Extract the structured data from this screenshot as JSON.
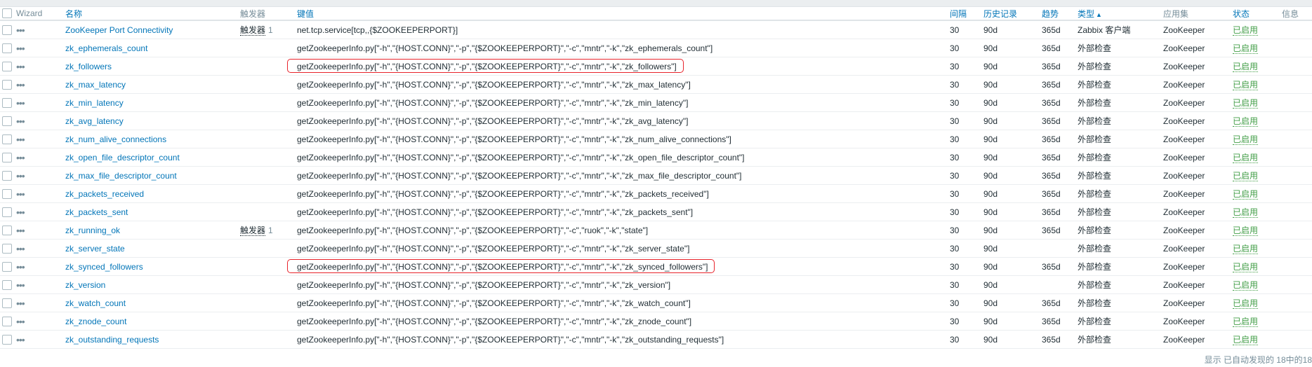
{
  "header": {
    "wizard": "Wizard",
    "name": "名称",
    "triggers": "触发器",
    "key": "键值",
    "interval": "间隔",
    "history": "历史记录",
    "trends": "趋势",
    "type": "类型",
    "sort_arrow": "▲",
    "application": "应用集",
    "status": "状态",
    "info": "信息"
  },
  "rows": [
    {
      "name": "ZooKeeper Port Connectivity",
      "trigger": "触发器",
      "trigger_count": "1",
      "key": "net.tcp.service[tcp,,{$ZOOKEEPERPORT}]",
      "interval": "30",
      "history": "90d",
      "trends": "365d",
      "type": "Zabbix 客户端",
      "app": "ZooKeeper",
      "status": "已启用",
      "highlight": false
    },
    {
      "name": "zk_ephemerals_count",
      "trigger": "",
      "trigger_count": "",
      "key": "getZookeeperInfo.py[\"-h\",\"{HOST.CONN}\",\"-p\",\"{$ZOOKEEPERPORT}\",\"-c\",\"mntr\",\"-k\",\"zk_ephemerals_count\"]",
      "interval": "30",
      "history": "90d",
      "trends": "365d",
      "type": "外部检查",
      "app": "ZooKeeper",
      "status": "已启用",
      "highlight": false
    },
    {
      "name": "zk_followers",
      "trigger": "",
      "trigger_count": "",
      "key": "getZookeeperInfo.py[\"-h\",\"{HOST.CONN}\",\"-p\",\"{$ZOOKEEPERPORT}\",\"-c\",\"mntr\",\"-k\",\"zk_followers\"]",
      "interval": "30",
      "history": "90d",
      "trends": "365d",
      "type": "外部检查",
      "app": "ZooKeeper",
      "status": "已启用",
      "highlight": true
    },
    {
      "name": "zk_max_latency",
      "trigger": "",
      "trigger_count": "",
      "key": "getZookeeperInfo.py[\"-h\",\"{HOST.CONN}\",\"-p\",\"{$ZOOKEEPERPORT}\",\"-c\",\"mntr\",\"-k\",\"zk_max_latency\"]",
      "interval": "30",
      "history": "90d",
      "trends": "365d",
      "type": "外部检查",
      "app": "ZooKeeper",
      "status": "已启用",
      "highlight": false
    },
    {
      "name": "zk_min_latency",
      "trigger": "",
      "trigger_count": "",
      "key": "getZookeeperInfo.py[\"-h\",\"{HOST.CONN}\",\"-p\",\"{$ZOOKEEPERPORT}\",\"-c\",\"mntr\",\"-k\",\"zk_min_latency\"]",
      "interval": "30",
      "history": "90d",
      "trends": "365d",
      "type": "外部检查",
      "app": "ZooKeeper",
      "status": "已启用",
      "highlight": false
    },
    {
      "name": "zk_avg_latency",
      "trigger": "",
      "trigger_count": "",
      "key": "getZookeeperInfo.py[\"-h\",\"{HOST.CONN}\",\"-p\",\"{$ZOOKEEPERPORT}\",\"-c\",\"mntr\",\"-k\",\"zk_avg_latency\"]",
      "interval": "30",
      "history": "90d",
      "trends": "365d",
      "type": "外部检查",
      "app": "ZooKeeper",
      "status": "已启用",
      "highlight": false
    },
    {
      "name": "zk_num_alive_connections",
      "trigger": "",
      "trigger_count": "",
      "key": "getZookeeperInfo.py[\"-h\",\"{HOST.CONN}\",\"-p\",\"{$ZOOKEEPERPORT}\",\"-c\",\"mntr\",\"-k\",\"zk_num_alive_connections\"]",
      "interval": "30",
      "history": "90d",
      "trends": "365d",
      "type": "外部检查",
      "app": "ZooKeeper",
      "status": "已启用",
      "highlight": false
    },
    {
      "name": "zk_open_file_descriptor_count",
      "trigger": "",
      "trigger_count": "",
      "key": "getZookeeperInfo.py[\"-h\",\"{HOST.CONN}\",\"-p\",\"{$ZOOKEEPERPORT}\",\"-c\",\"mntr\",\"-k\",\"zk_open_file_descriptor_count\"]",
      "interval": "30",
      "history": "90d",
      "trends": "365d",
      "type": "外部检查",
      "app": "ZooKeeper",
      "status": "已启用",
      "highlight": false
    },
    {
      "name": "zk_max_file_descriptor_count",
      "trigger": "",
      "trigger_count": "",
      "key": "getZookeeperInfo.py[\"-h\",\"{HOST.CONN}\",\"-p\",\"{$ZOOKEEPERPORT}\",\"-c\",\"mntr\",\"-k\",\"zk_max_file_descriptor_count\"]",
      "interval": "30",
      "history": "90d",
      "trends": "365d",
      "type": "外部检查",
      "app": "ZooKeeper",
      "status": "已启用",
      "highlight": false
    },
    {
      "name": "zk_packets_received",
      "trigger": "",
      "trigger_count": "",
      "key": "getZookeeperInfo.py[\"-h\",\"{HOST.CONN}\",\"-p\",\"{$ZOOKEEPERPORT}\",\"-c\",\"mntr\",\"-k\",\"zk_packets_received\"]",
      "interval": "30",
      "history": "90d",
      "trends": "365d",
      "type": "外部检查",
      "app": "ZooKeeper",
      "status": "已启用",
      "highlight": false
    },
    {
      "name": "zk_packets_sent",
      "trigger": "",
      "trigger_count": "",
      "key": "getZookeeperInfo.py[\"-h\",\"{HOST.CONN}\",\"-p\",\"{$ZOOKEEPERPORT}\",\"-c\",\"mntr\",\"-k\",\"zk_packets_sent\"]",
      "interval": "30",
      "history": "90d",
      "trends": "365d",
      "type": "外部检查",
      "app": "ZooKeeper",
      "status": "已启用",
      "highlight": false
    },
    {
      "name": "zk_running_ok",
      "trigger": "触发器",
      "trigger_count": "1",
      "key": "getZookeeperInfo.py[\"-h\",\"{HOST.CONN}\",\"-p\",\"{$ZOOKEEPERPORT}\",\"-c\",\"ruok\",\"-k\",\"state\"]",
      "interval": "30",
      "history": "90d",
      "trends": "365d",
      "type": "外部检查",
      "app": "ZooKeeper",
      "status": "已启用",
      "highlight": false
    },
    {
      "name": "zk_server_state",
      "trigger": "",
      "trigger_count": "",
      "key": "getZookeeperInfo.py[\"-h\",\"{HOST.CONN}\",\"-p\",\"{$ZOOKEEPERPORT}\",\"-c\",\"mntr\",\"-k\",\"zk_server_state\"]",
      "interval": "30",
      "history": "90d",
      "trends": "",
      "type": "外部检查",
      "app": "ZooKeeper",
      "status": "已启用",
      "highlight": false
    },
    {
      "name": "zk_synced_followers",
      "trigger": "",
      "trigger_count": "",
      "key": "getZookeeperInfo.py[\"-h\",\"{HOST.CONN}\",\"-p\",\"{$ZOOKEEPERPORT}\",\"-c\",\"mntr\",\"-k\",\"zk_synced_followers\"]",
      "interval": "30",
      "history": "90d",
      "trends": "365d",
      "type": "外部检查",
      "app": "ZooKeeper",
      "status": "已启用",
      "highlight": true
    },
    {
      "name": "zk_version",
      "trigger": "",
      "trigger_count": "",
      "key": "getZookeeperInfo.py[\"-h\",\"{HOST.CONN}\",\"-p\",\"{$ZOOKEEPERPORT}\",\"-c\",\"mntr\",\"-k\",\"zk_version\"]",
      "interval": "30",
      "history": "90d",
      "trends": "",
      "type": "外部检查",
      "app": "ZooKeeper",
      "status": "已启用",
      "highlight": false
    },
    {
      "name": "zk_watch_count",
      "trigger": "",
      "trigger_count": "",
      "key": "getZookeeperInfo.py[\"-h\",\"{HOST.CONN}\",\"-p\",\"{$ZOOKEEPERPORT}\",\"-c\",\"mntr\",\"-k\",\"zk_watch_count\"]",
      "interval": "30",
      "history": "90d",
      "trends": "365d",
      "type": "外部检查",
      "app": "ZooKeeper",
      "status": "已启用",
      "highlight": false
    },
    {
      "name": "zk_znode_count",
      "trigger": "",
      "trigger_count": "",
      "key": "getZookeeperInfo.py[\"-h\",\"{HOST.CONN}\",\"-p\",\"{$ZOOKEEPERPORT}\",\"-c\",\"mntr\",\"-k\",\"zk_znode_count\"]",
      "interval": "30",
      "history": "90d",
      "trends": "365d",
      "type": "外部检查",
      "app": "ZooKeeper",
      "status": "已启用",
      "highlight": false
    },
    {
      "name": "zk_outstanding_requests",
      "trigger": "",
      "trigger_count": "",
      "key": "getZookeeperInfo.py[\"-h\",\"{HOST.CONN}\",\"-p\",\"{$ZOOKEEPERPORT}\",\"-c\",\"mntr\",\"-k\",\"zk_outstanding_requests\"]",
      "interval": "30",
      "history": "90d",
      "trends": "365d",
      "type": "外部检查",
      "app": "ZooKeeper",
      "status": "已启用",
      "highlight": false
    }
  ],
  "footer": {
    "text": "显示 已自动发现的 18中的18"
  },
  "icons": {
    "row_menu": "more-dots-icon"
  },
  "colors": {
    "link": "#0275b8",
    "enabled": "#429e47",
    "highlight_border": "#e8232b"
  }
}
